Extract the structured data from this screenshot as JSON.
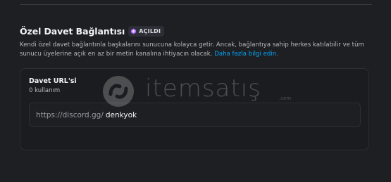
{
  "section": {
    "title": "Özel Davet Bağlantısı",
    "badge": "AÇILDI",
    "description_text": "Kendi özel davet bağlantınla başkalarını sunucuna kolayca getir. Ancak, bağlantıya sahip herkes katılabilir ve tüm sunucu üyelerine açık en az bir metin kanalına ihtiyacın olacak. ",
    "learn_more": "Daha fazla bilgi edin."
  },
  "invite": {
    "label": "Davet URL'si",
    "usage": "0 kullanım",
    "url_prefix": "https://discord.gg/",
    "url_value": "denkyok"
  },
  "watermark": {
    "brand": "itemsatış",
    "domain": ".com"
  },
  "colors": {
    "background": "#1e1f22",
    "card": "#1b1c1f",
    "link": "#00a8fc",
    "badge_icon": "#a866ff"
  }
}
